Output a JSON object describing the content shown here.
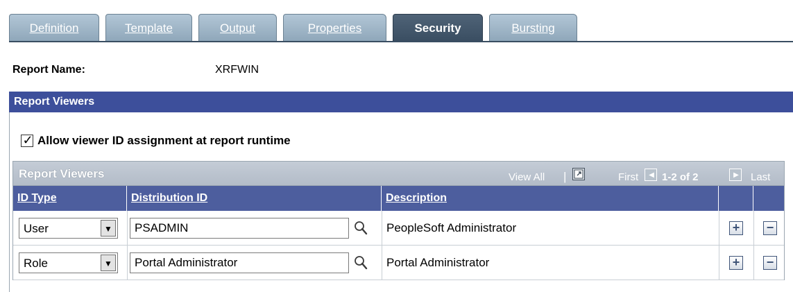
{
  "tabs": [
    {
      "label": "Definition",
      "active": false
    },
    {
      "label": "Template",
      "active": false
    },
    {
      "label": "Output",
      "active": false
    },
    {
      "label": "Properties",
      "active": false
    },
    {
      "label": "Security",
      "active": true
    },
    {
      "label": "Bursting",
      "active": false
    }
  ],
  "report": {
    "name_label": "Report Name:",
    "name_value": "XRFWIN"
  },
  "viewers_section": {
    "header": "Report Viewers",
    "checkbox_label": "Allow viewer ID assignment at report runtime",
    "checkbox_checked": true
  },
  "grid": {
    "title": "Report Viewers",
    "view_all": "View All",
    "first": "First",
    "range": "1-2 of 2",
    "last": "Last",
    "columns": [
      "ID Type",
      "Distribution ID",
      "Description"
    ],
    "rows": [
      {
        "id_type": "User",
        "distribution_id": "PSADMIN",
        "description": "PeopleSoft Administrator"
      },
      {
        "id_type": "Role",
        "distribution_id": "Portal Administrator",
        "description": "Portal Administrator"
      }
    ]
  },
  "colors": {
    "header_blue": "#3d4f9b",
    "column_header": "#4d5e9e",
    "active_tab": "#3a4e62",
    "inactive_tab": "#a3b8c9"
  },
  "icons": {
    "lookup": "magnifier-icon",
    "add_row": "plus-icon",
    "delete_row": "minus-icon",
    "dropdown": "triangle-down-icon",
    "view_all": "view-all-icon",
    "prev": "arrow-left-icon",
    "next": "arrow-right-icon"
  }
}
